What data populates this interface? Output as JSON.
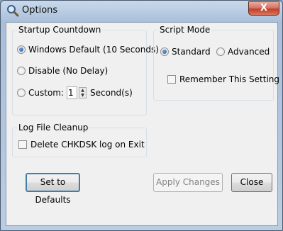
{
  "window": {
    "title": "Options",
    "close_glyph": "X"
  },
  "startup": {
    "legend": "Startup Countdown",
    "options": [
      {
        "label": "Windows Default (10 Seconds)",
        "selected": true
      },
      {
        "label": "Disable (No Delay)",
        "selected": false
      },
      {
        "label": "Custom:",
        "selected": false
      }
    ],
    "custom_value": "1",
    "custom_unit": "Second(s)"
  },
  "script_mode": {
    "legend": "Script Mode",
    "standard_label": "Standard",
    "standard_selected": true,
    "advanced_label": "Advanced",
    "advanced_selected": false,
    "remember_label": "Remember This Setting",
    "remember_checked": false
  },
  "log_cleanup": {
    "legend": "Log File Cleanup",
    "delete_label": "Delete CHKDSK log on Exit",
    "delete_checked": false
  },
  "buttons": {
    "defaults": "Set to Defaults",
    "apply": "Apply Changes",
    "close": "Close"
  },
  "icons": {
    "title": "magnifier-icon"
  }
}
